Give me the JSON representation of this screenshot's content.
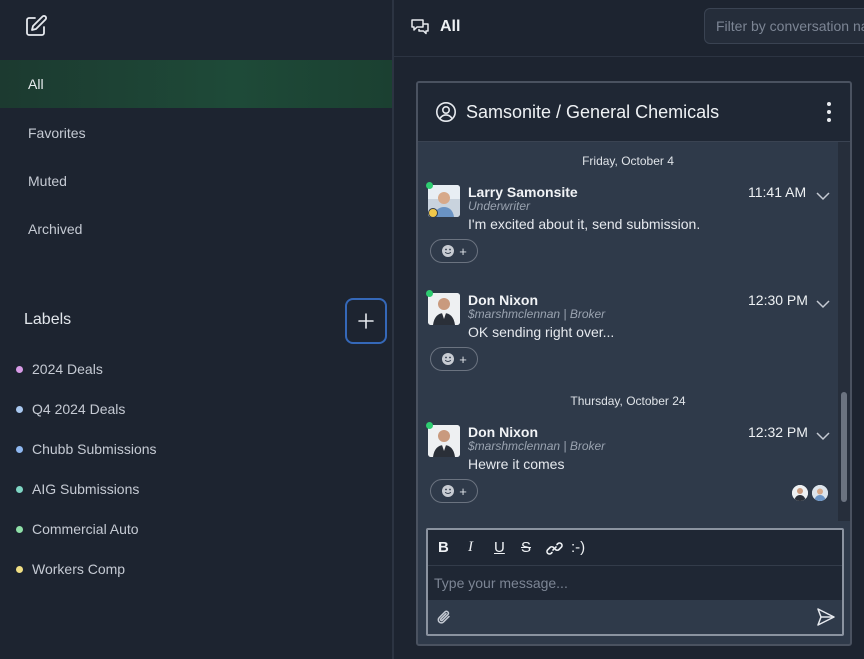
{
  "sidebar": {
    "nav": [
      {
        "label": "All",
        "active": true
      },
      {
        "label": "Favorites",
        "active": false
      },
      {
        "label": "Muted",
        "active": false
      },
      {
        "label": "Archived",
        "active": false
      }
    ],
    "labels_title": "Labels",
    "labels": [
      {
        "name": "2024 Deals",
        "color": "#d79be6"
      },
      {
        "name": "Q4 2024 Deals",
        "color": "#a9c8ef"
      },
      {
        "name": "Chubb Submissions",
        "color": "#8fb8f0"
      },
      {
        "name": "AIG Submissions",
        "color": "#7fd6c4"
      },
      {
        "name": "Commercial Auto",
        "color": "#8fe0a8"
      },
      {
        "name": "Workers Comp",
        "color": "#f0df84"
      }
    ]
  },
  "topbar": {
    "title": "All",
    "filter_placeholder": "Filter by conversation name"
  },
  "conversation": {
    "title": "Samsonite / General Chemicals",
    "date_separators": [
      "Friday, October 4",
      "Thursday, October 24"
    ],
    "messages": [
      {
        "sender": "Larry Samonsite",
        "role": "Underwriter",
        "text": "I'm excited about it, send submission.",
        "time": "11:41 AM"
      },
      {
        "sender": "Don Nixon",
        "role": "$marshmclennan | Broker",
        "text": "OK sending right over...",
        "time": "12:30 PM"
      },
      {
        "sender": "Don Nixon",
        "role": "$marshmclennan | Broker",
        "text": "Hewre it comes",
        "time": "12:32 PM"
      }
    ]
  },
  "composer": {
    "bold": "B",
    "italic": "I",
    "underline": "U",
    "strike": "S",
    "emoji": ":-)",
    "placeholder": "Type your message..."
  },
  "colors": {
    "accent": "#3568b8",
    "presence": "#2ecc71",
    "active_nav": "#1e4a38"
  }
}
